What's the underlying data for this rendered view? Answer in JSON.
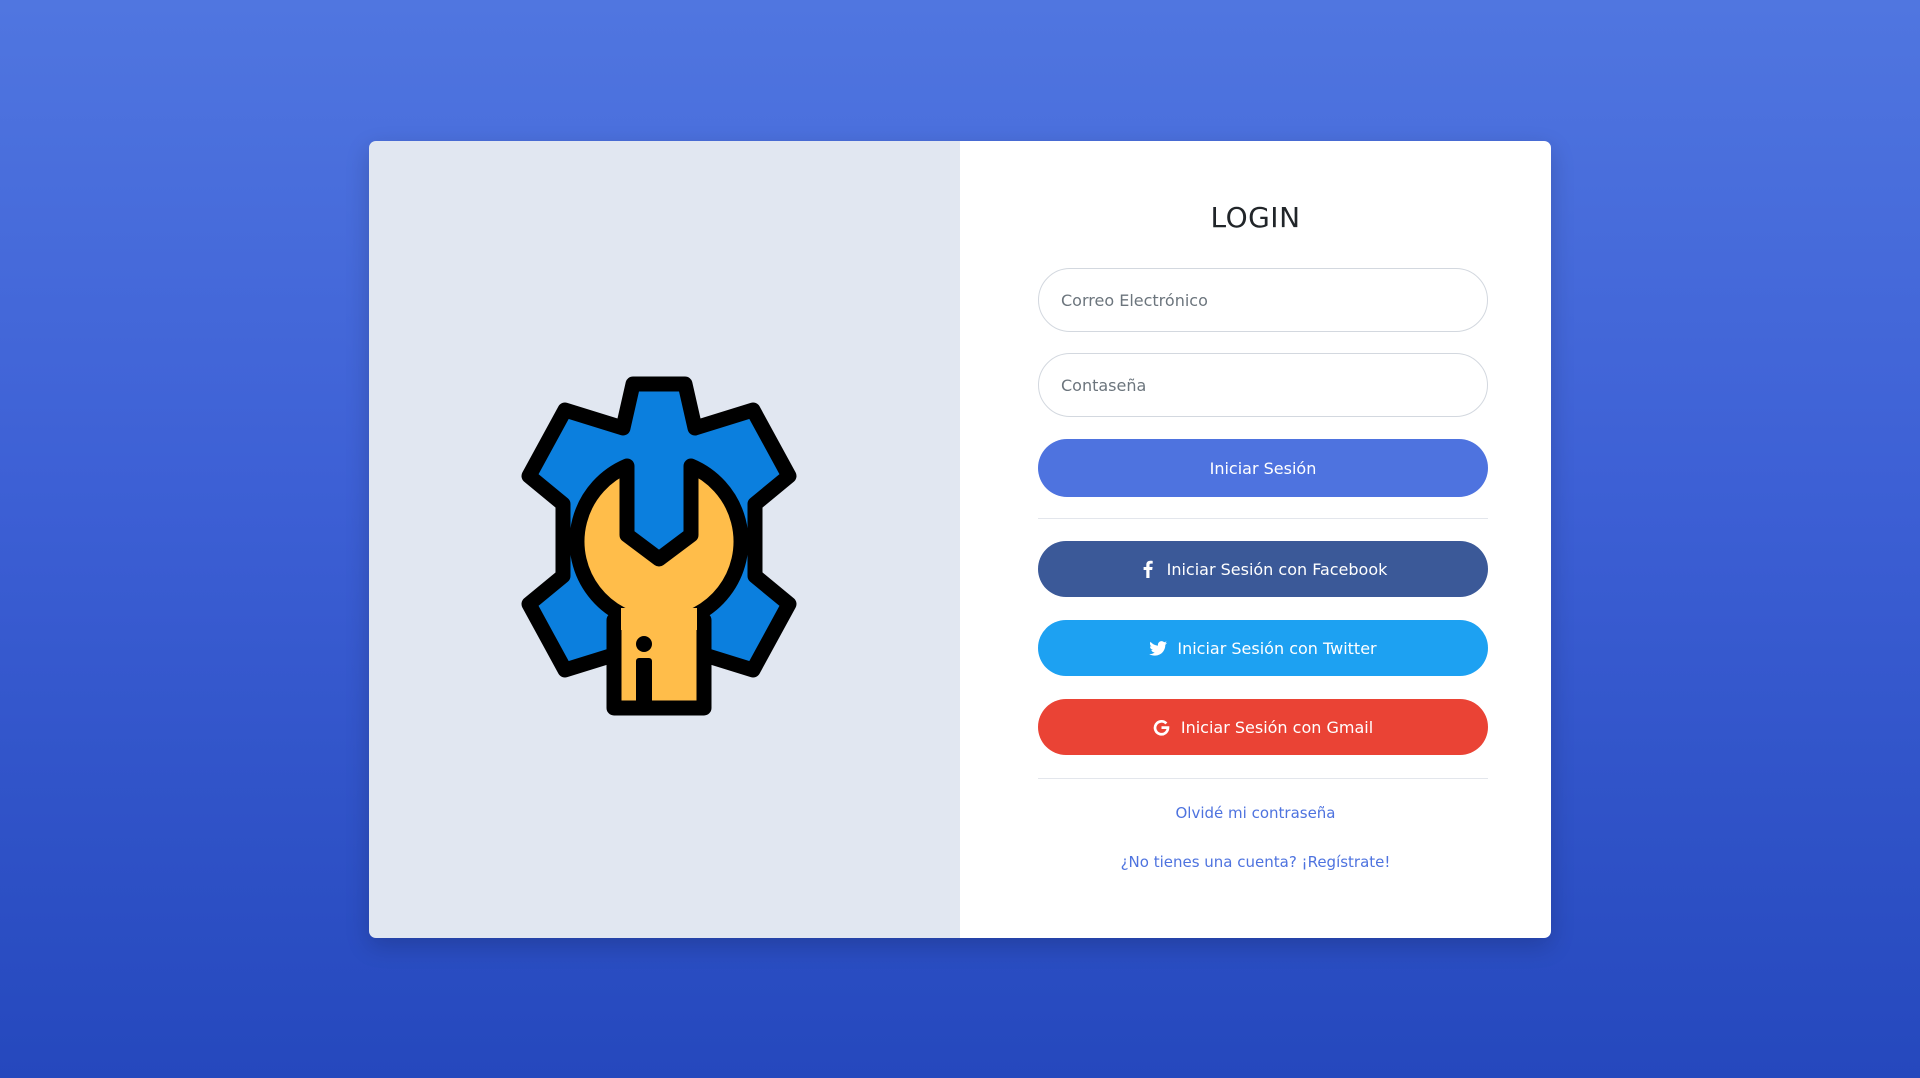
{
  "login": {
    "title": "LOGIN",
    "email_placeholder": "Correo Electrónico",
    "password_placeholder": "Contaseña",
    "submit_label": "Iniciar Sesión",
    "facebook_label": "Iniciar Sesión con Facebook",
    "twitter_label": "Iniciar Sesión con Twitter",
    "gmail_label": "Iniciar Sesión con Gmail",
    "forgot_label": "Olvidé mi contraseña",
    "register_label": "¿No tienes una cuenta? ¡Regístrate!"
  },
  "icons": {
    "logo": "gear-wrench-icon",
    "facebook": "facebook-icon",
    "twitter": "twitter-icon",
    "gmail": "google-icon"
  },
  "colors": {
    "primary": "#4e73df",
    "facebook": "#3b5998",
    "twitter": "#1da1f2",
    "gmail": "#ea4335",
    "left_panel": "#e1e7f1",
    "gear_blue": "#0b7fde",
    "wrench_yellow": "#ffbd4a"
  }
}
